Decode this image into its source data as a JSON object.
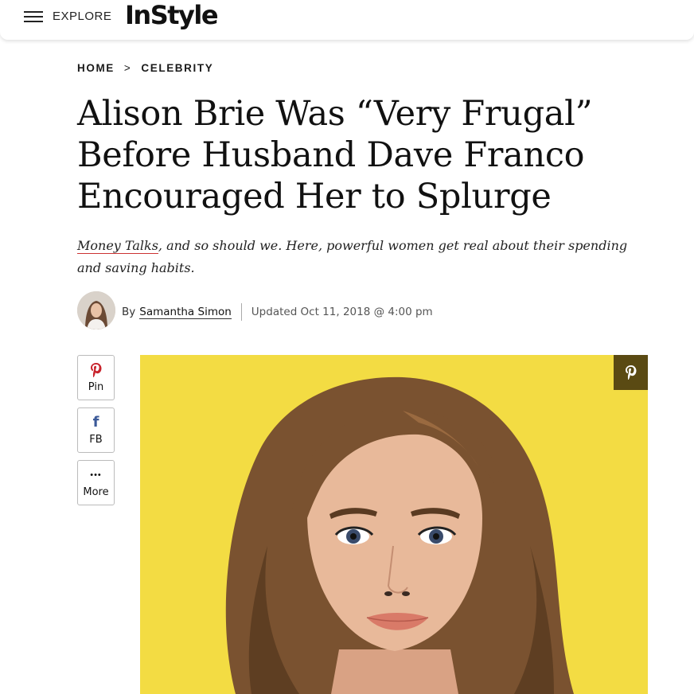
{
  "header": {
    "explore_label": "EXPLORE",
    "logo_text": "InStyle"
  },
  "breadcrumb": {
    "items": [
      "HOME",
      "CELEBRITY"
    ],
    "separator": ">"
  },
  "article": {
    "headline": "Alison Brie Was “Very Frugal” Before Husband Dave Franco Encouraged Her to Splurge",
    "dek_link": "Money Talks",
    "dek_rest": ", and so should we. Here, powerful women get real about their spending and saving habits.",
    "byline_prefix": "By",
    "author": "Samantha Simon",
    "updated": "Updated Oct 11, 2018 @ 4:00 pm"
  },
  "share": {
    "pin_icon": "P",
    "pin_label": "Pin",
    "fb_icon": "f",
    "fb_label": "FB",
    "more_icon": "•••",
    "more_label": "More"
  },
  "hero": {
    "pin_icon": "P",
    "background_color": "#f3dc43",
    "hair_color": "#7a5230",
    "skin_color": "#e8b99a"
  },
  "colors": {
    "pin_red": "#c8232c",
    "fb_blue": "#3b5998",
    "pin_overlay": "#5a4a13"
  }
}
